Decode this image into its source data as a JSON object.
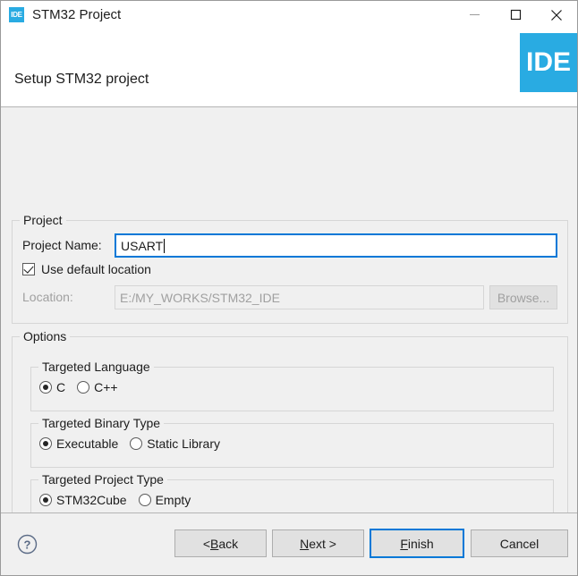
{
  "window": {
    "title": "STM32 Project",
    "app_icon_text": "IDE",
    "controls": {
      "minimize": "minimize-icon",
      "maximize": "maximize-icon",
      "close": "close-icon"
    }
  },
  "header": {
    "title": "Setup STM32 project",
    "logo_text": "IDE",
    "logo_color": "#29abe2"
  },
  "project_group": {
    "legend": "Project",
    "name_label": "Project Name:",
    "name_value": "USART",
    "name_placeholder": "",
    "use_default_location_label": "Use default location",
    "use_default_location_checked": true,
    "location_label": "Location:",
    "location_value": "E:/MY_WORKS/STM32_IDE",
    "browse_label": "Browse..."
  },
  "options_group": {
    "legend": "Options",
    "language": {
      "legend": "Targeted Language",
      "options": [
        {
          "label": "C",
          "selected": true
        },
        {
          "label": "C++",
          "selected": false
        }
      ]
    },
    "binary_type": {
      "legend": "Targeted Binary Type",
      "options": [
        {
          "label": "Executable",
          "selected": true
        },
        {
          "label": "Static Library",
          "selected": false
        }
      ]
    },
    "project_type": {
      "legend": "Targeted Project Type",
      "options": [
        {
          "label": "STM32Cube",
          "selected": true
        },
        {
          "label": "Empty",
          "selected": false
        }
      ]
    }
  },
  "footer": {
    "help_icon": "help-circle-icon",
    "buttons": {
      "back": {
        "prefix": "< ",
        "mnemonic": "B",
        "suffix": "ack"
      },
      "next": {
        "prefix": "",
        "mnemonic": "N",
        "suffix": "ext >"
      },
      "finish": {
        "prefix": "",
        "mnemonic": "F",
        "suffix": "inish",
        "default": true
      },
      "cancel": {
        "prefix": "",
        "mnemonic": "",
        "suffix": "Cancel"
      }
    }
  },
  "colors": {
    "accent": "#0078d7",
    "brand": "#29abe2",
    "dialog_bg": "#f0f0f0"
  }
}
